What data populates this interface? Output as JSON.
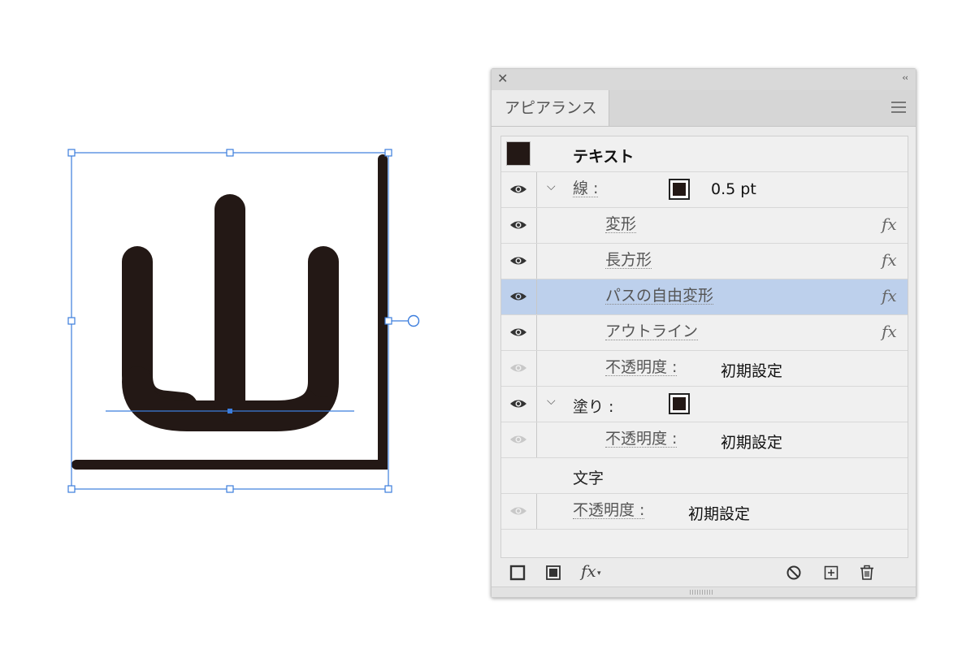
{
  "panel": {
    "close_icon": "close-icon",
    "collapse_glyph": "‹‹",
    "tab_label": "アピアランス",
    "rows": [
      {
        "label": "テキスト"
      },
      {
        "label": "線 :",
        "value": "0.5 pt"
      },
      {
        "label": "変形",
        "fx": "fx"
      },
      {
        "label": "長方形",
        "fx": "fx"
      },
      {
        "label": "パスの自由変形",
        "fx": "fx",
        "selected": true
      },
      {
        "label": "アウトライン",
        "fx": "fx"
      },
      {
        "label": "不透明度 :",
        "value": "初期設定"
      },
      {
        "label": "塗り :"
      },
      {
        "label": "不透明度 :",
        "value": "初期設定"
      },
      {
        "label": "文字"
      },
      {
        "label": "不透明度 :",
        "value": "初期設定"
      }
    ],
    "bottom_fx": "fx"
  },
  "colors": {
    "accent": "#3b7ddd",
    "ink": "#231815",
    "selection": "#bdd0ec"
  }
}
